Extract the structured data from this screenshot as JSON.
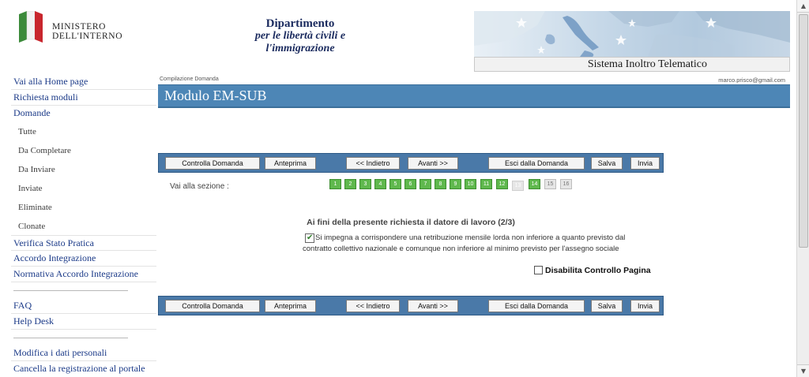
{
  "header": {
    "ministry_line1": "MINISTERO",
    "ministry_line2": "DELL'INTERNO",
    "dept_title": "Dipartimento",
    "dept_sub1": "per le libertà civili e",
    "dept_sub2": "l'immigrazione",
    "system_name": "Sistema Inoltro Telematico"
  },
  "sidebar": {
    "home": "Vai alla Home page",
    "richiesta_moduli": "Richiesta moduli",
    "domande": "Domande",
    "sub": [
      "Tutte",
      "Da Completare",
      "Da Inviare",
      "Inviate",
      "Eliminate",
      "Clonate"
    ],
    "verifica": "Verifica Stato Pratica",
    "accordo": "Accordo Integrazione",
    "normativa": "Normativa Accordo Integrazione",
    "faq": "FAQ",
    "help": "Help Desk",
    "modifica": "Modifica i dati personali",
    "cancella": "Cancella la registrazione al portale"
  },
  "main": {
    "breadcrumb": "Compilazione Domanda",
    "user_email": "marco.prisco@gmail.com",
    "page_title": "Modulo EM-SUB",
    "toolbar": {
      "controlla": "Controlla Domanda",
      "anteprima": "Anteprima",
      "indietro": "<< Indietro",
      "avanti": "Avanti >>",
      "esci": "Esci dalla Domanda",
      "salva": "Salva",
      "invia": "Invia"
    },
    "section_label": "Vai alla sezione :",
    "sections": [
      "1",
      "2",
      "3",
      "4",
      "5",
      "6",
      "7",
      "8",
      "9",
      "10",
      "11",
      "12",
      "13",
      "14",
      "15",
      "16"
    ],
    "current_section": "13",
    "question_title": "Ai fini della presente richiesta il datore di lavoro (2/3)",
    "commitment_line1": "Si impegna a corrispondere una retribuzione mensile lorda non inferiore a quanto previsto dal",
    "commitment_line2": "contratto collettivo nazionale e comunque non inferiore al minimo previsto per l'assegno sociale",
    "commitment_checked": true,
    "disable_label": "Disabilita Controllo Pagina",
    "disable_checked": false
  },
  "colors": {
    "title_bar": "#4d86b6",
    "toolbar": "#4a79a8",
    "section_done": "#5fb84d",
    "link": "#1b3a88"
  },
  "icons": {
    "flag": "italian-flag-icon",
    "check": "checkmark-icon",
    "scroll_up": "arrow-up-icon",
    "scroll_down": "arrow-down-icon"
  }
}
